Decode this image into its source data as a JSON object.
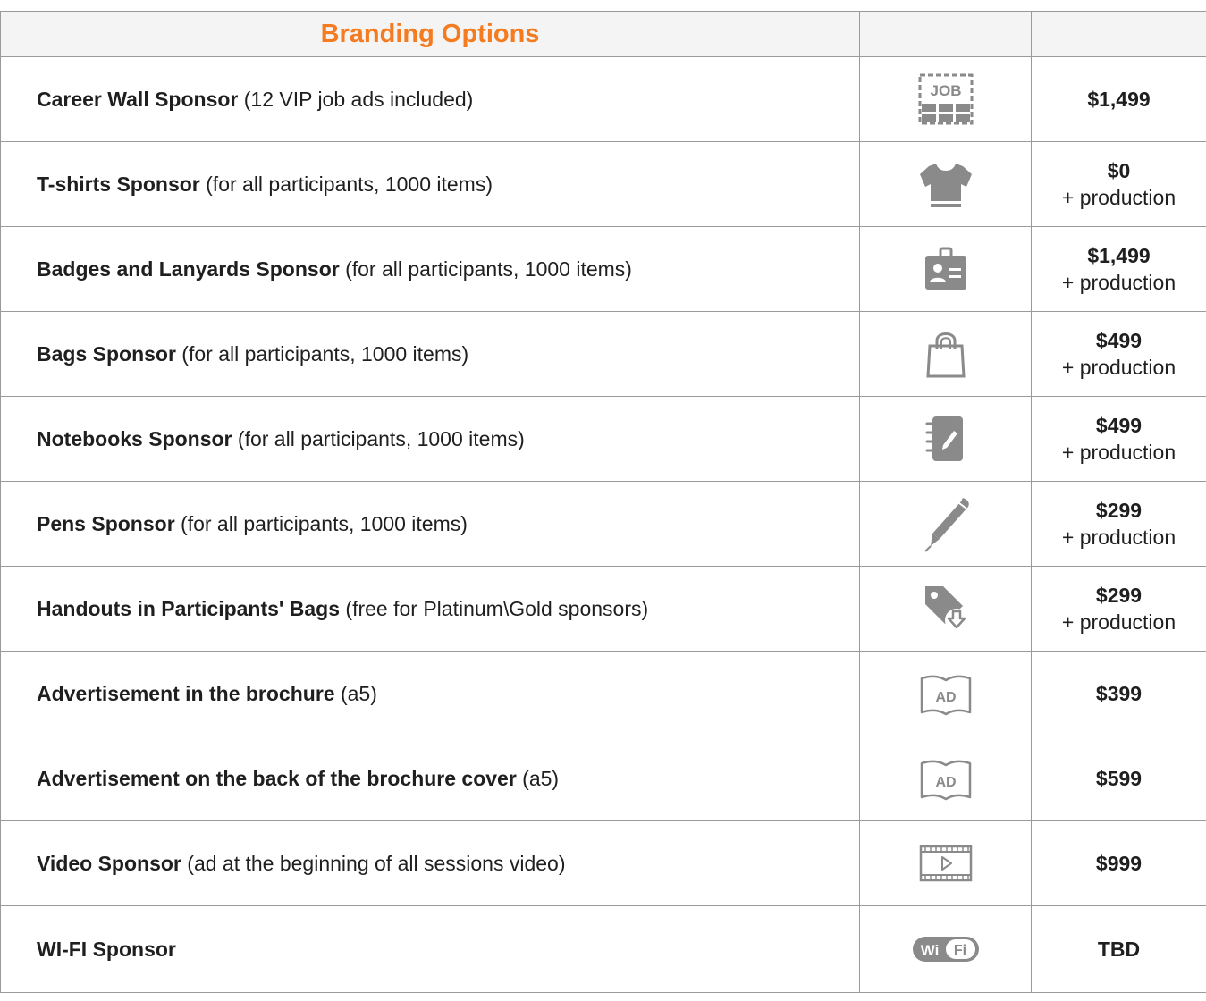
{
  "header": {
    "title": "Branding Options"
  },
  "colors": {
    "accent": "#f47b20",
    "icon": "#8a8a8a",
    "border": "#9a9a9a"
  },
  "rows": [
    {
      "name": "Career Wall Sponsor",
      "detail": " (12 VIP job ads included)",
      "icon": "job-board-icon",
      "price": "$1,499",
      "note": ""
    },
    {
      "name": "T-shirts Sponsor",
      "detail": " (for all participants, 1000 items)",
      "icon": "t-shirt-icon",
      "price": "$0",
      "note": "+ production"
    },
    {
      "name": "Badges and Lanyards Sponsor",
      "detail": " (for all participants, 1000 items)",
      "icon": "badge-icon",
      "price": "$1,499",
      "note": "+ production"
    },
    {
      "name": "Bags Sponsor",
      "detail": " (for all participants, 1000 items)",
      "icon": "bag-icon",
      "price": "$499",
      "note": "+ production"
    },
    {
      "name": "Notebooks Sponsor",
      "detail": " (for all participants, 1000 items)",
      "icon": "notebook-icon",
      "price": "$499",
      "note": "+ production"
    },
    {
      "name": "Pens Sponsor",
      "detail": " (for all participants, 1000 items)",
      "icon": "pen-icon",
      "price": "$299",
      "note": "+ production"
    },
    {
      "name": "Handouts in Participants' Bags",
      "detail": " (free for Platinum\\Gold sponsors)",
      "icon": "tag-download-icon",
      "price": "$299",
      "note": "+ production"
    },
    {
      "name": "Advertisement in the brochure",
      "detail": " (a5)",
      "icon": "ad-book-icon",
      "price": "$399",
      "note": ""
    },
    {
      "name": "Advertisement on the back of the brochure cover",
      "detail": " (a5)",
      "icon": "ad-book-icon",
      "price": "$599",
      "note": ""
    },
    {
      "name": "Video Sponsor",
      "detail": " (ad at the beginning of all sessions video)",
      "icon": "video-film-icon",
      "price": "$999",
      "note": ""
    },
    {
      "name": "WI-FI Sponsor",
      "detail": "",
      "icon": "wifi-logo-icon",
      "price": "TBD",
      "note": ""
    }
  ],
  "icon_text": {
    "job": "JOB",
    "ad": "AD",
    "wifi_wi": "Wi",
    "wifi_fi": "Fi"
  }
}
